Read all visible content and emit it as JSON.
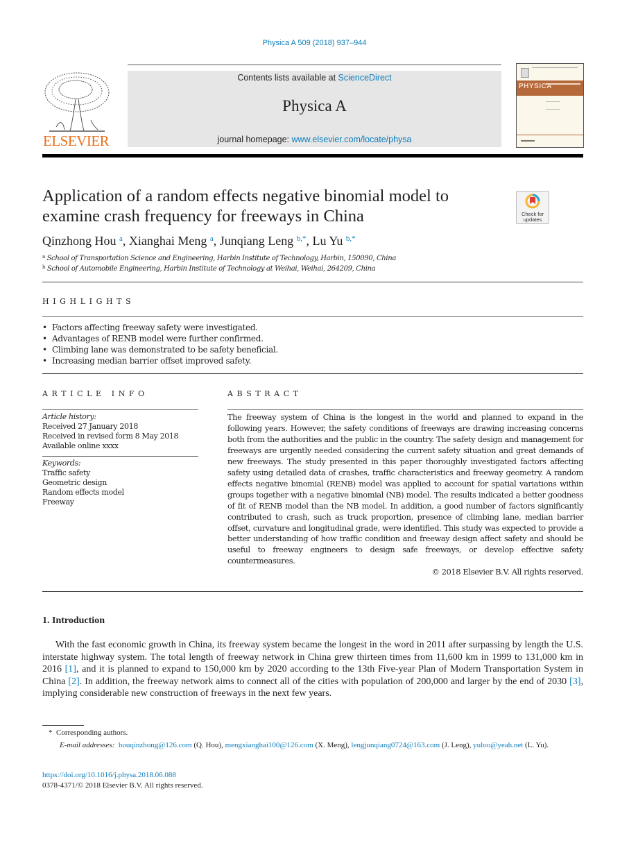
{
  "citation": "Physica A 509 (2018) 937–944",
  "header": {
    "contents_prefix": "Contents lists available at ",
    "contents_link": "ScienceDirect",
    "journal_name": "Physica A",
    "homepage_prefix": "journal homepage: ",
    "homepage_link": "www.elsevier.com/locate/physa",
    "publisher_logo_text": "ELSEVIER",
    "cover_title": "PHYSICA",
    "badge_label_1": "Check for",
    "badge_label_2": "updates"
  },
  "article": {
    "title": "Application of a random effects negative binomial model to examine crash frequency for freeways in China",
    "authors": [
      {
        "name": "Qinzhong Hou",
        "sup": "a"
      },
      {
        "name": "Xianghai Meng",
        "sup": "a"
      },
      {
        "name": "Junqiang Leng",
        "sup": "b,*"
      },
      {
        "name": "Lu Yu",
        "sup": "b,*"
      }
    ],
    "affiliations": [
      {
        "sup": "a",
        "text": "School of Transportation Science and Engineering, Harbin Institute of Technology, Harbin, 150090, China"
      },
      {
        "sup": "b",
        "text": "School of Automobile Engineering, Harbin Institute of Technology at Weihai, Weihai, 264209, China"
      }
    ]
  },
  "highlights": {
    "heading": "HIGHLIGHTS",
    "items": [
      "Factors affecting freeway safety were investigated.",
      "Advantages of RENB model were further confirmed.",
      "Climbing lane was demonstrated to be safety beneficial.",
      "Increasing median barrier offset improved safety."
    ]
  },
  "article_info": {
    "heading": "ARTICLE INFO",
    "history_label": "Article history:",
    "history": [
      "Received 27 January 2018",
      "Received in revised form 8 May 2018",
      "Available online xxxx"
    ],
    "keywords_label": "Keywords:",
    "keywords": [
      "Traffic safety",
      "Geometric design",
      "Random effects model",
      "Freeway"
    ]
  },
  "abstract": {
    "heading": "ABSTRACT",
    "text": "The freeway system of China is the longest in the world and planned to expand in the following years. However, the safety conditions of freeways are drawing increasing concerns both from the authorities and the public in the country. The safety design and management for freeways are urgently needed considering the current safety situation and great demands of new freeways. The study presented in this paper thoroughly investigated factors affecting safety using detailed data of crashes, traffic characteristics and freeway geometry. A random effects negative binomial (RENB) model was applied to account for spatial variations within groups together with a negative binomial (NB) model. The results indicated a better goodness of fit of RENB model than the NB model. In addition, a good number of factors significantly contributed to crash, such as truck proportion, presence of climbing lane, median barrier offset, curvature and longitudinal grade, were identified. This study was expected to provide a better understanding of how traffic condition and freeway design affect safety and should be useful to freeway engineers to design safe freeways, or develop effective safety countermeasures.",
    "copyright": "© 2018 Elsevier B.V. All rights reserved."
  },
  "introduction": {
    "heading": "1.  Introduction",
    "p1": "With the fast economic growth in China, its freeway system became the longest in the word in 2011 after surpassing by length the U.S. interstate highway system. The total length of freeway network in China grew thirteen times from 11,600 km in 1999 to 131,000 km in 2016 ",
    "ref1": "[1]",
    "p2": ", and it is planned to expand to 150,000 km by 2020 according to the 13th Five-year Plan of Modern Transportation System in China ",
    "ref2": "[2]",
    "p3": ". In addition, the freeway network aims to connect all of the cities with population of 200,000 and larger by the end of 2030 ",
    "ref3": "[3]",
    "p4": ", implying considerable new construction of freeways in the next few years."
  },
  "footnote": {
    "star": "*",
    "corresponding": "Corresponding authors.",
    "email_label": "E-mail addresses:",
    "emails": [
      {
        "email": "houqinzhong@126.com",
        "who": " (Q. Hou), "
      },
      {
        "email": "mengxianghai100@126.com",
        "who": " (X. Meng), "
      },
      {
        "email": "lengjunqiang0724@163.com",
        "who": " (J. Leng), "
      },
      {
        "email": "yuloo@yeah.net",
        "who": " (L. Yu)."
      }
    ],
    "doi": "https://doi.org/10.1016/j.physa.2018.06.088",
    "issn_copyright": "0378-4371/© 2018 Elsevier B.V. All rights reserved."
  }
}
